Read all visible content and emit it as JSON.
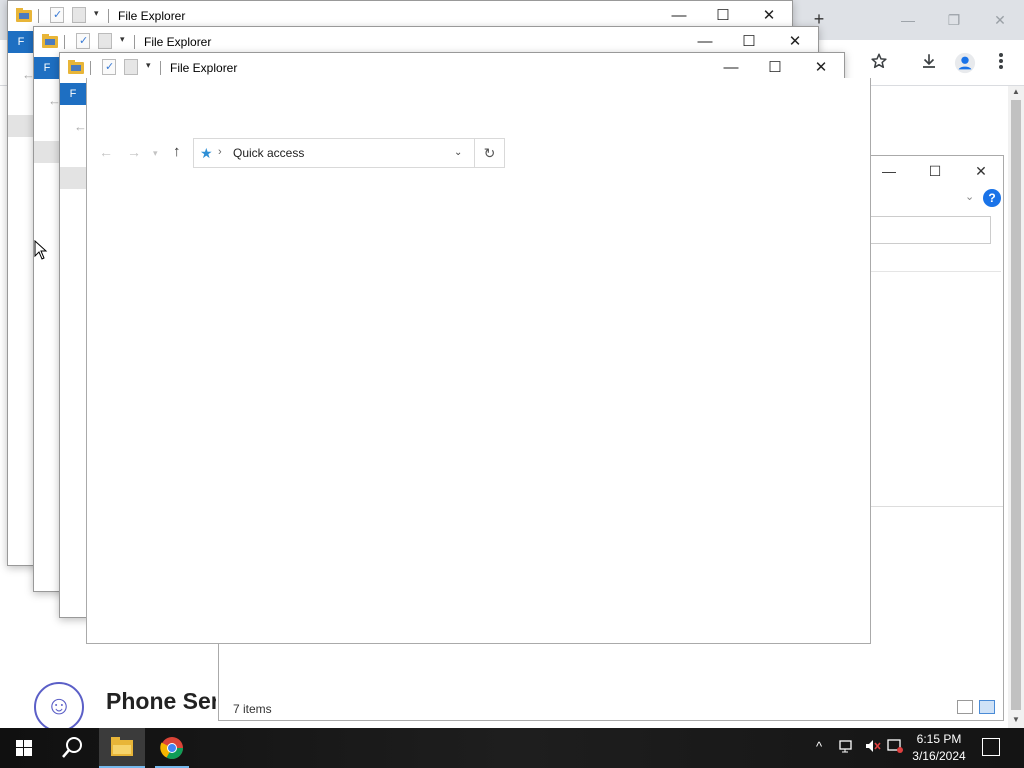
{
  "chrome": {
    "new_tab_label": "+",
    "minimize_label": "—",
    "restore_label": "❐",
    "close_label": "✕"
  },
  "background_page": {
    "phone_title": "Phone Ser",
    "phone_avatar_glyph": "☺"
  },
  "background_explorer": {
    "minimize_label": "—",
    "maximize_label": "☐",
    "close_label": "✕",
    "help_label": "?",
    "status_text": "7 items"
  },
  "explorer_windows": [
    {
      "title": "File Explorer",
      "ribbon_label": "F"
    },
    {
      "title": "File Explorer",
      "ribbon_label": "F"
    },
    {
      "title": "File Explorer",
      "ribbon_label": "F"
    }
  ],
  "window_controls": {
    "minimize": "—",
    "maximize": "☐",
    "close": "✕"
  },
  "front_explorer": {
    "title": "File Explorer",
    "address": "Quick access",
    "back_label": "←",
    "forward_label": "→",
    "recent_label": "▾",
    "up_label": "↑",
    "refresh_label": "↻",
    "breadcrumb_separator": "›"
  },
  "taskbar": {
    "time": "6:15 PM",
    "date": "3/16/2024",
    "tray_chevron": "^"
  },
  "colors": {
    "accent_blue": "#1e6fc2",
    "folder_yellow": "#e8b538",
    "taskbar_bg": "#1a1a1a",
    "active_indicator": "#76b9ed"
  }
}
